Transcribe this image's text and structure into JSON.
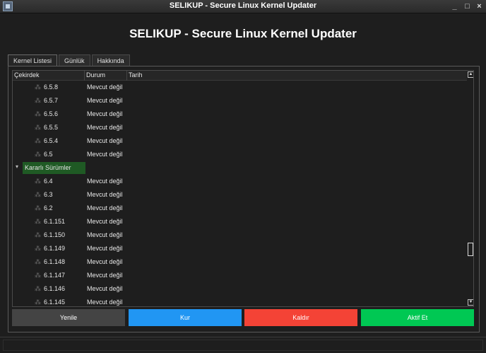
{
  "window": {
    "title": "SELIKUP - Secure Linux Kernel Updater",
    "app_icon": "selikup-app-icon",
    "controls": {
      "minimize": "_",
      "maximize": "□",
      "close": "×"
    }
  },
  "header": {
    "title": "SELIKUP - Secure Linux Kernel Updater"
  },
  "tabs": [
    {
      "label": "Kernel Listesi",
      "active": true
    },
    {
      "label": "Günlük",
      "active": false
    },
    {
      "label": "Hakkında",
      "active": false
    }
  ],
  "tree": {
    "columns": [
      "Çekirdek",
      "Durum",
      "Tarih"
    ],
    "rows_before_group": [
      {
        "kernel": "6.5.8",
        "status": "Mevcut değil",
        "icon": "tux-icon"
      },
      {
        "kernel": "6.5.7",
        "status": "Mevcut değil",
        "icon": "tux-icon"
      },
      {
        "kernel": "6.5.6",
        "status": "Mevcut değil",
        "icon": "tux-icon"
      },
      {
        "kernel": "6.5.5",
        "status": "Mevcut değil",
        "icon": "tux-icon"
      },
      {
        "kernel": "6.5.4",
        "status": "Mevcut değil",
        "icon": "tux-icon"
      },
      {
        "kernel": "6.5",
        "status": "Mevcut değil",
        "icon": "tux-icon"
      }
    ],
    "group": {
      "label": "Kararlı Sürümler",
      "expanded": true,
      "highlight": "#1f5a24"
    },
    "rows_after_group": [
      {
        "kernel": "6.4",
        "status": "Mevcut değil",
        "icon": "tux-icon"
      },
      {
        "kernel": "6.3",
        "status": "Mevcut değil",
        "icon": "tux-icon"
      },
      {
        "kernel": "6.2",
        "status": "Mevcut değil",
        "icon": "tux-icon"
      },
      {
        "kernel": "6.1.151",
        "status": "Mevcut değil",
        "icon": "tux-icon"
      },
      {
        "kernel": "6.1.150",
        "status": "Mevcut değil",
        "icon": "tux-icon"
      },
      {
        "kernel": "6.1.149",
        "status": "Mevcut değil",
        "icon": "tux-icon"
      },
      {
        "kernel": "6.1.148",
        "status": "Mevcut değil",
        "icon": "tux-icon"
      },
      {
        "kernel": "6.1.147",
        "status": "Mevcut değil",
        "icon": "tux-icon"
      },
      {
        "kernel": "6.1.146",
        "status": "Mevcut değil",
        "icon": "tux-icon"
      },
      {
        "kernel": "6.1.145",
        "status": "Mevcut değil",
        "icon": "tux-icon"
      }
    ]
  },
  "actions": {
    "refresh": {
      "label": "Yenile",
      "color": "#444444"
    },
    "install": {
      "label": "Kur",
      "color": "#2196f3"
    },
    "remove": {
      "label": "Kaldır",
      "color": "#f44336"
    },
    "activate": {
      "label": "Aktif Et",
      "color": "#00c853"
    }
  },
  "statusbar": {
    "text": ""
  }
}
